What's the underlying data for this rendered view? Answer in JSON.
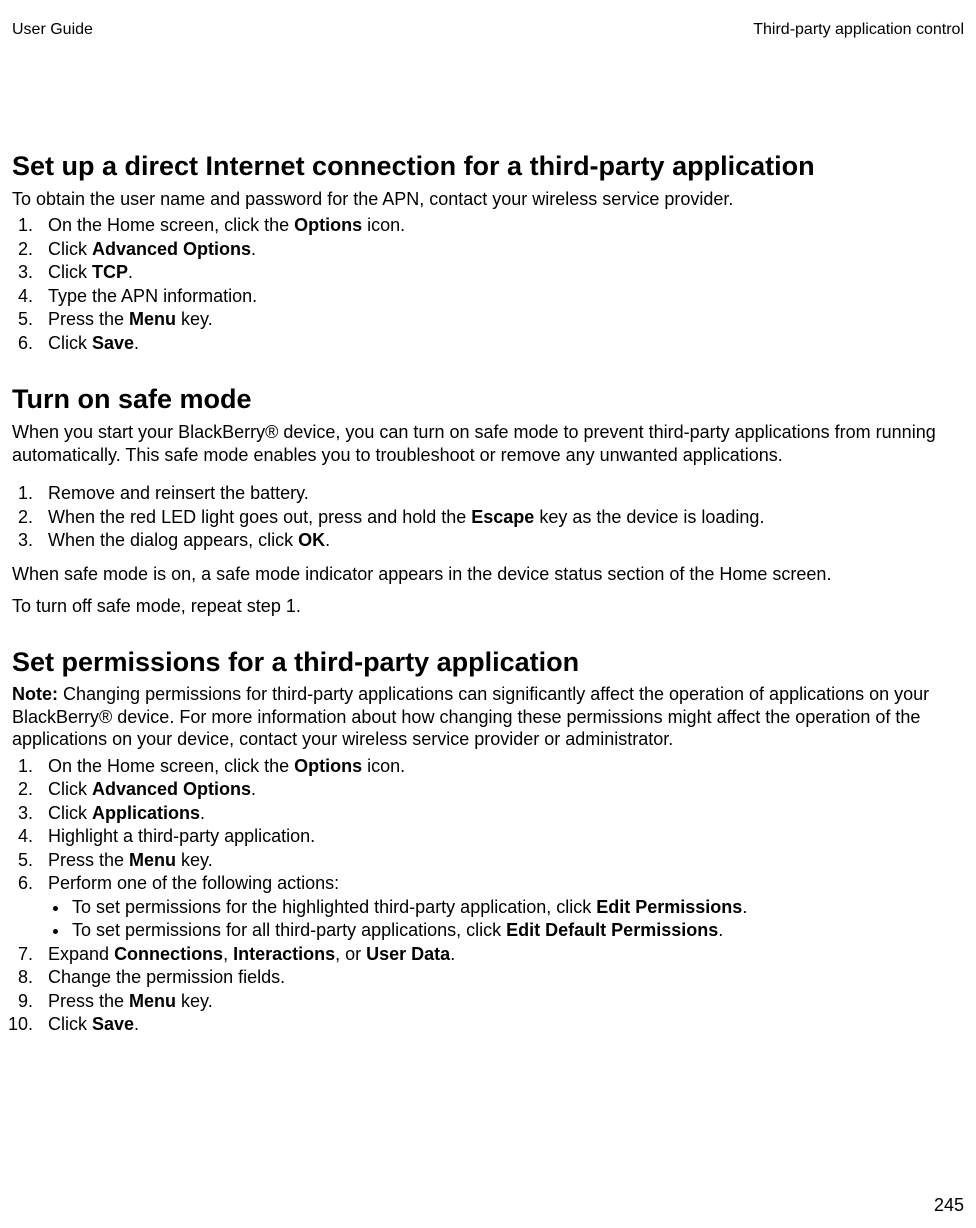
{
  "header": {
    "left": "User Guide",
    "right": "Third-party application control"
  },
  "footer": {
    "page_number": "245"
  },
  "s1": {
    "title": "Set up a direct Internet connection for a third-party application",
    "intro": "To obtain the user name and password for the APN, contact your wireless service provider.",
    "step1_a": "On the Home screen, click the ",
    "step1_b": "Options",
    "step1_c": " icon.",
    "step2_a": "Click ",
    "step2_b": "Advanced Options",
    "step2_c": ".",
    "step3_a": "Click ",
    "step3_b": "TCP",
    "step3_c": ".",
    "step4": "Type the APN information.",
    "step5_a": "Press the ",
    "step5_b": "Menu",
    "step5_c": " key.",
    "step6_a": "Click ",
    "step6_b": "Save",
    "step6_c": "."
  },
  "s2": {
    "title": "Turn on safe mode",
    "intro": "When you start your BlackBerry® device, you can turn on safe mode to prevent third-party applications from running automatically. This safe mode enables you to troubleshoot or remove any unwanted applications.",
    "step1": "Remove and reinsert the battery.",
    "step2_a": "When the red LED light goes out, press and hold the ",
    "step2_b": "Escape",
    "step2_c": " key as the device is loading.",
    "step3_a": "When the dialog appears, click ",
    "step3_b": "OK",
    "step3_c": ".",
    "after1": "When safe mode is on, a safe mode indicator appears in the device status section of the Home screen.",
    "after2": "To turn off safe mode, repeat step 1."
  },
  "s3": {
    "title": "Set permissions for a third-party application",
    "note_label": "Note:",
    "note_body": "  Changing permissions for third-party applications can significantly affect the operation of applications on your BlackBerry® device. For more information about how changing these permissions might affect the operation of the applications on your device, contact your wireless service provider or administrator.",
    "step1_a": "On the Home screen, click the ",
    "step1_b": "Options",
    "step1_c": " icon.",
    "step2_a": "Click ",
    "step2_b": "Advanced Options",
    "step2_c": ".",
    "step3_a": "Click ",
    "step3_b": "Applications",
    "step3_c": ".",
    "step4": "Highlight a third-party application.",
    "step5_a": "Press the ",
    "step5_b": "Menu",
    "step5_c": " key.",
    "step6": "Perform one of the following actions:",
    "bullet1_a": "To set permissions for the highlighted third-party application, click ",
    "bullet1_b": "Edit Permissions",
    "bullet1_c": ".",
    "bullet2_a": "To set permissions for all third-party applications, click ",
    "bullet2_b": "Edit Default Permissions",
    "bullet2_c": ".",
    "step7_a": "Expand ",
    "step7_b": "Connections",
    "step7_c": ", ",
    "step7_d": "Interactions",
    "step7_e": ", or ",
    "step7_f": "User Data",
    "step7_g": ".",
    "step8": "Change the permission fields.",
    "step9_a": "Press the ",
    "step9_b": "Menu",
    "step9_c": " key.",
    "step10_a": "Click ",
    "step10_b": "Save",
    "step10_c": "."
  }
}
